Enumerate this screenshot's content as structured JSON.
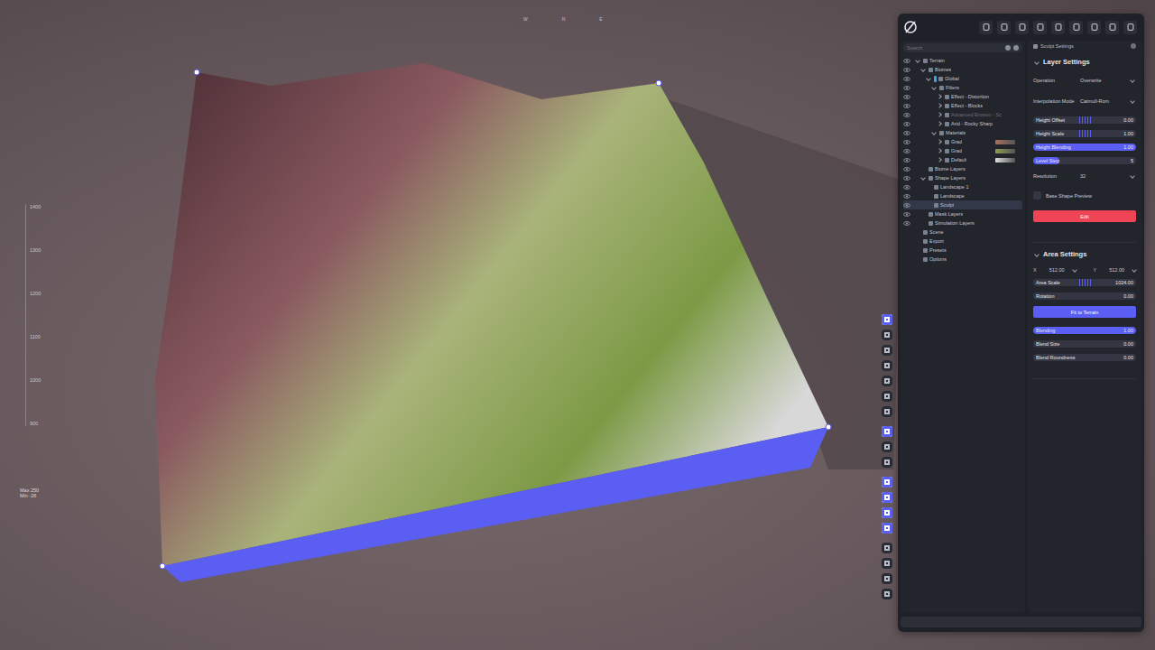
{
  "viewport": {
    "compass": [
      "W",
      "N",
      "E"
    ],
    "ruler": [
      "1400",
      "1300",
      "1200",
      "1100",
      "1000",
      "900"
    ],
    "stats": [
      "Max 250",
      "Min -26"
    ]
  },
  "viewport_tools": [
    [
      {
        "selected": true
      },
      {
        "selected": false
      },
      {
        "selected": false
      },
      {
        "selected": false
      },
      {
        "selected": false
      },
      {
        "selected": false
      },
      {
        "selected": false
      }
    ],
    [
      {
        "selected": true
      },
      {
        "selected": false
      },
      {
        "selected": false
      }
    ],
    [
      {
        "selected": true
      },
      {
        "selected": true
      },
      {
        "selected": true
      },
      {
        "selected": true
      }
    ],
    [
      {
        "selected": false
      },
      {
        "selected": false
      },
      {
        "selected": false
      },
      {
        "selected": false
      }
    ]
  ],
  "tree": {
    "search": {
      "placeholder": "Search"
    },
    "items": [
      {
        "label": "Terrain",
        "expanded": true,
        "selected": false,
        "disabled": false,
        "visible": true,
        "children": [
          {
            "label": "Biomes",
            "expanded": true,
            "selected": false,
            "disabled": false,
            "visible": true,
            "children": [
              {
                "label": "Global",
                "expanded": true,
                "selected": false,
                "disabled": false,
                "visible": true,
                "color": "#3aa6e8",
                "children": [
                  {
                    "label": "Filters",
                    "expanded": true,
                    "selected": false,
                    "disabled": false,
                    "visible": true,
                    "children": [
                      {
                        "label": "Effect - Distortion",
                        "expanded": false,
                        "selected": false,
                        "disabled": false,
                        "visible": true
                      },
                      {
                        "label": "Effect - Blocks",
                        "expanded": false,
                        "selected": false,
                        "disabled": false,
                        "visible": true
                      },
                      {
                        "label": "Advanced Erosion - Sc",
                        "expanded": false,
                        "selected": false,
                        "disabled": true,
                        "visible": true
                      },
                      {
                        "label": "Arid - Rocky Sharp",
                        "expanded": false,
                        "selected": false,
                        "disabled": false,
                        "visible": true
                      }
                    ]
                  },
                  {
                    "label": "Materials",
                    "expanded": true,
                    "selected": false,
                    "disabled": false,
                    "visible": true,
                    "children": [
                      {
                        "label": "Grad",
                        "expanded": false,
                        "selected": false,
                        "disabled": false,
                        "visible": true,
                        "color": "#a8705e"
                      },
                      {
                        "label": "Grad",
                        "expanded": false,
                        "selected": false,
                        "disabled": false,
                        "visible": true,
                        "color": "#8c9c52"
                      },
                      {
                        "label": "Default",
                        "expanded": false,
                        "selected": false,
                        "disabled": false,
                        "visible": true,
                        "color": "#e0e0e0"
                      }
                    ]
                  }
                ]
              }
            ]
          },
          {
            "label": "Biome Layers",
            "expanded": false,
            "selected": false,
            "disabled": false,
            "visible": true
          },
          {
            "label": "Shape Layers",
            "expanded": true,
            "selected": false,
            "disabled": false,
            "visible": true,
            "children": [
              {
                "label": "Landscape 1",
                "expanded": false,
                "selected": false,
                "disabled": false,
                "visible": true
              },
              {
                "label": "Landscape",
                "expanded": false,
                "selected": false,
                "disabled": false,
                "visible": true
              },
              {
                "label": "Sculpt",
                "expanded": false,
                "selected": true,
                "disabled": false,
                "visible": true
              }
            ]
          },
          {
            "label": "Mask Layers",
            "expanded": false,
            "selected": false,
            "disabled": false,
            "visible": true
          },
          {
            "label": "Simulation Layers",
            "expanded": false,
            "selected": false,
            "disabled": false,
            "visible": true
          }
        ]
      },
      {
        "label": "Scene",
        "expanded": false,
        "selected": false,
        "disabled": false,
        "visible": false
      },
      {
        "label": "Export",
        "expanded": false,
        "selected": false,
        "disabled": false,
        "visible": false
      },
      {
        "label": "Presets",
        "expanded": false,
        "selected": false,
        "disabled": false,
        "visible": false
      },
      {
        "label": "Options",
        "expanded": false,
        "selected": false,
        "disabled": false,
        "visible": false
      }
    ]
  },
  "settings": {
    "header": "Sculpt Settings",
    "sections": [
      {
        "title": "Layer Settings",
        "expanded": true,
        "rows": [
          {
            "kind": "select",
            "label": "Operation",
            "value": "Overwrite"
          },
          {
            "kind": "select",
            "label": "Interpolation Mode",
            "value": "Catmull-Rom"
          },
          {
            "kind": "centered",
            "label": "Height Offset",
            "value": "0.00",
            "level": 0.45
          },
          {
            "kind": "centered",
            "label": "Height Scale",
            "value": "1.00",
            "level": 0.45
          },
          {
            "kind": "slider",
            "label": "Height Blending",
            "value": "1.00",
            "level": 1.0
          },
          {
            "kind": "slider",
            "label": "Level Step",
            "value": "5",
            "level": 0.25
          },
          {
            "kind": "select",
            "label": "Resolution",
            "value": "32"
          },
          {
            "kind": "checkbox",
            "label": "Base Shape Preview",
            "checked": false
          },
          {
            "kind": "button",
            "label": "Edit",
            "color": "#ef4456"
          }
        ]
      },
      {
        "title": "Area Settings",
        "expanded": true,
        "rows": [
          {
            "kind": "xy",
            "fields": [
              {
                "label": "X",
                "value": "512.00"
              },
              {
                "label": "Y",
                "value": "512.00"
              }
            ]
          },
          {
            "kind": "centered",
            "label": "Area Scale",
            "value": "1024.00",
            "level": 0.45
          },
          {
            "kind": "slider",
            "label": "Rotation",
            "value": "0.00",
            "level": 0.0
          },
          {
            "kind": "button",
            "label": "Fit to Terrain",
            "color": "#5b5ef2"
          },
          {
            "kind": "slider",
            "label": "Blending",
            "value": "1.00",
            "level": 1.0
          },
          {
            "kind": "slider",
            "label": "Blend Size",
            "value": "0.00",
            "level": 0.0
          },
          {
            "kind": "slider",
            "label": "Blend Roundness",
            "value": "0.00",
            "level": 0.0
          }
        ]
      }
    ]
  }
}
